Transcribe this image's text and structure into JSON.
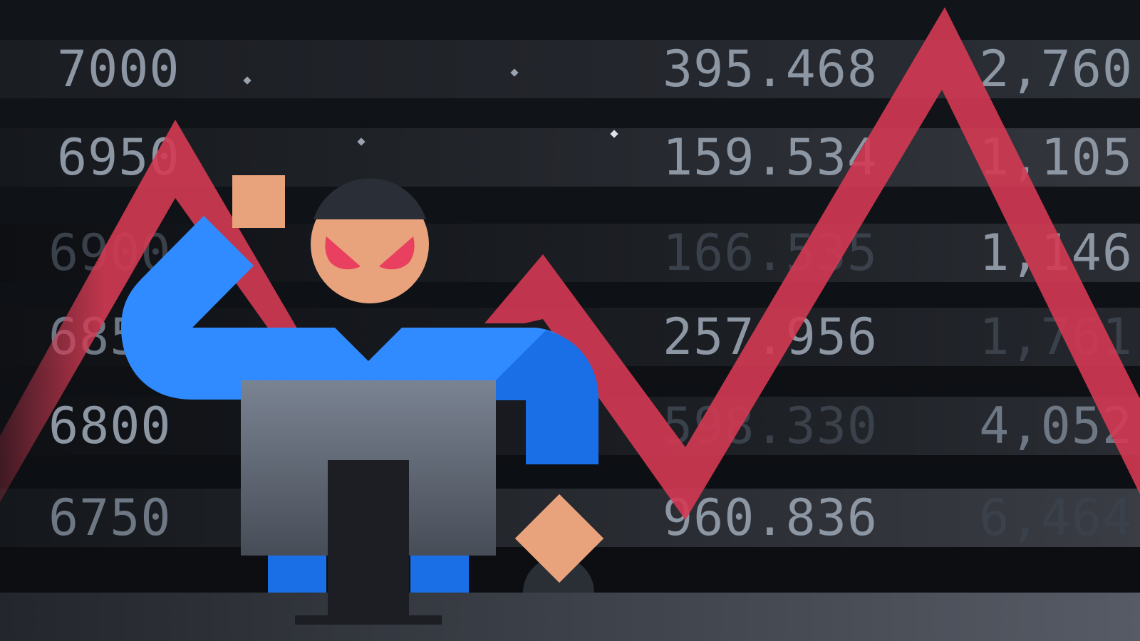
{
  "rows": [
    {
      "left": "7000",
      "mid": "395.468",
      "right": "2,760"
    },
    {
      "left": "6950",
      "mid": "159.534",
      "right": "1,105"
    },
    {
      "left": "6900",
      "mid": "166.535",
      "right": "1,146"
    },
    {
      "left": "6850",
      "mid": "257.956",
      "right": "1,761"
    },
    {
      "left": "6800",
      "mid": "598.330",
      "right": "4,052"
    },
    {
      "left": "6750",
      "mid": "960.836",
      "right": "6,464"
    }
  ],
  "colors": {
    "background": "#0c0e12",
    "zigzag": "#d43a53",
    "figure_blue": "#2f8bff",
    "figure_blue_dark": "#1a6fe6",
    "skin": "#e8a27c",
    "monitor": "#6b7482",
    "desk": "#3a3f48"
  },
  "icons": [
    "hacker-figure-icon",
    "computer-monitor-icon",
    "zigzag-trend-line-icon"
  ]
}
